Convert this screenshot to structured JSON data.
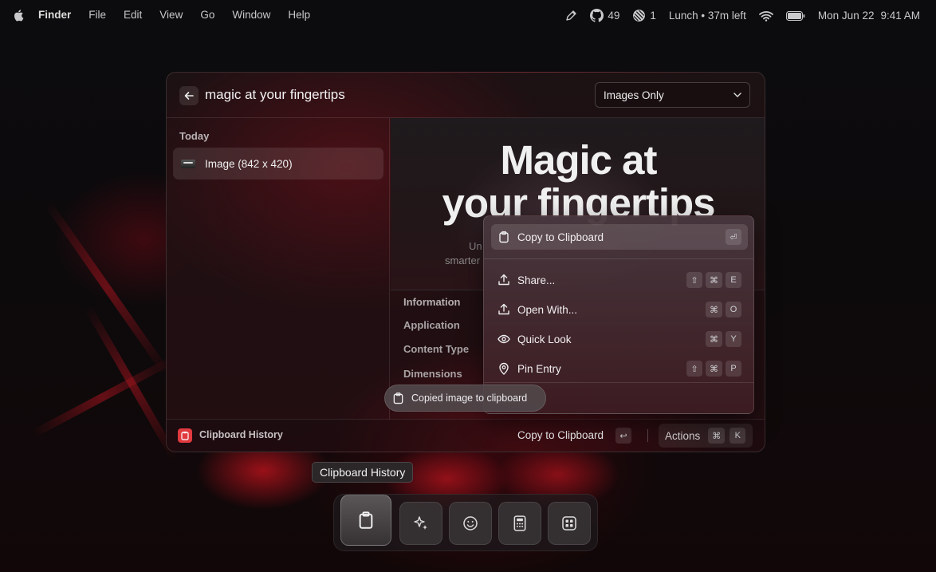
{
  "menubar": {
    "menus": [
      "Finder",
      "File",
      "Edit",
      "View",
      "Go",
      "Window",
      "Help"
    ],
    "github_count": "49",
    "linear_count": "1",
    "calendar_status": "Lunch • 37m left",
    "date": "Mon Jun 22",
    "time": "9:41 AM",
    "icons": [
      "apple-logo",
      "pen-icon",
      "github-icon",
      "linear-icon",
      "wifi-icon",
      "battery-icon"
    ]
  },
  "window": {
    "search_text": "magic at your fingertips",
    "filter_value": "Images Only",
    "section_title": "Today",
    "items": [
      {
        "label": "Image (842 x 420)"
      }
    ],
    "preview": {
      "heading_line1": "Magic at",
      "heading_line2": "your fingertips",
      "sub_line1": "Un",
      "sub_line2": "smarter"
    },
    "info": {
      "title": "Information",
      "rows": [
        "Application",
        "Content Type",
        "Dimensions"
      ]
    },
    "footer": {
      "title": "Clipboard History",
      "primary_action": "Copy to Clipboard",
      "enter_key": "↩",
      "actions_label": "Actions",
      "actions_keys": [
        "⌘",
        "K"
      ]
    }
  },
  "action_panel": {
    "primary": {
      "label": "Copy to Clipboard",
      "keys": [
        "⏎"
      ]
    },
    "items": [
      {
        "label": "Share...",
        "keys": [
          "⇧",
          "⌘",
          "E"
        ]
      },
      {
        "label": "Open With...",
        "keys": [
          "⌘",
          "O"
        ]
      },
      {
        "label": "Quick Look",
        "keys": [
          "⌘",
          "Y"
        ]
      },
      {
        "label": "Pin Entry",
        "keys": [
          "⇧",
          "⌘",
          "P"
        ]
      }
    ]
  },
  "toast": {
    "text": "Copied image to clipboard"
  },
  "tooltip": {
    "text": "Clipboard History"
  },
  "dock": {
    "items": [
      "clipboard-icon",
      "sparkles-icon",
      "emoji-icon",
      "calculator-icon",
      "extensions-icon"
    ],
    "active": "clipboard-icon"
  },
  "colors": {
    "accent": "#e03a3f",
    "background": "#0d0a0c"
  }
}
